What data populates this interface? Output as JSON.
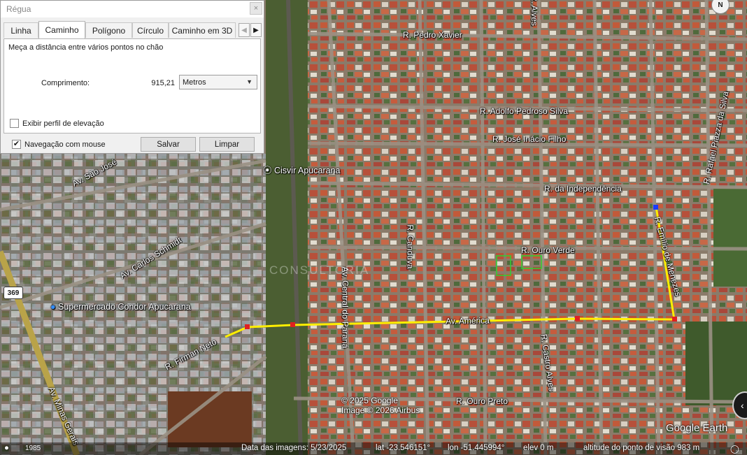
{
  "dialog": {
    "title": "Régua",
    "close_icon": "×",
    "tabs": [
      "Linha",
      "Caminho",
      "Polígono",
      "Círculo",
      "Caminho em 3D"
    ],
    "active_tab": "Caminho",
    "description": "Meça a distância entre vários pontos no chão",
    "length_label": "Comprimento:",
    "length_value": "915,21",
    "unit_selected": "Metros",
    "elevation_profile_label": "Exibir perfil de elevação",
    "elevation_profile_checked": false,
    "mouse_nav_label": "Navegação com mouse",
    "mouse_nav_checked": true,
    "save_label": "Salvar",
    "clear_label": "Limpar"
  },
  "map": {
    "street_labels": [
      "R. Pedro Xavier",
      "R. Adolfo Pedroso Silva",
      "R. José Inácio Filho",
      "R. da Independência",
      "R. Ouro Verde",
      "Av. São José",
      "Av. Carlos Schmidt",
      "R. Canduva",
      "Av. Central do Paraná",
      "Av. América",
      "R. Firman Neto",
      "R. Castro Alves",
      "R. Ouro Preto",
      "Av. Minas Gerais",
      "R. Emílio de Menezes",
      "R. Rafael Piazza da Silva",
      "R. Alves"
    ],
    "poi_labels": [
      "Cisvir Apucarana",
      "Supermercado Condor Apucarana"
    ],
    "road_shield": "369",
    "watermark": "CONSULTORIA",
    "compass": "N",
    "copyright_lines": [
      "© 2025 Google",
      "Image © 2026 Airbus"
    ],
    "brand": "Google Earth",
    "path_color": "#ffee00",
    "point_color": "#e02020"
  },
  "status": {
    "scale_text": "1985",
    "image_date": "Data das imagens: 5/23/2025",
    "lat": "lat  -23.546151°",
    "lon": "lon  -51.445994°",
    "elev": "elev     0 m",
    "eye_alt": "altitude do ponto de visão   983 m"
  }
}
